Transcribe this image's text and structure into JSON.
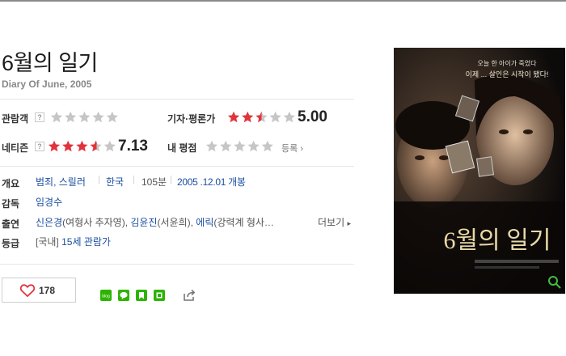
{
  "movie": {
    "title": "6월의 일기",
    "subtitle": "Diary Of June, 2005"
  },
  "ratings": {
    "audience": {
      "label": "관람객",
      "help": "?",
      "score": 0.0
    },
    "critic": {
      "label": "기자·평론가",
      "score": 5.0,
      "score_text": "5.00"
    },
    "netizen": {
      "label": "네티즌",
      "help": "?",
      "score": 7.13,
      "score_text": "7.13"
    },
    "my": {
      "label": "내 평점",
      "score": 0.0,
      "action": "등록"
    }
  },
  "info": {
    "overview_label": "개요",
    "genre": "범죄, 스릴러",
    "country": "한국",
    "runtime": "105분",
    "release": "2005 .12.01 개봉",
    "director_label": "감독",
    "director": "임경수",
    "cast_label": "출연",
    "cast": [
      {
        "name": "신은경",
        "role": "(여형사 추자영)"
      },
      {
        "name": "김윤진",
        "role": "(서윤희)"
      },
      {
        "name": "에릭",
        "role": "(강력계 형사…"
      }
    ],
    "cast_sep": ", ",
    "more_label": "더보기",
    "grade_label": "등급",
    "grade_prefix": "[국내]",
    "grade": "15세 관람가"
  },
  "actions": {
    "like_count": "178",
    "share_icons": [
      "blog-share-icon",
      "line-share-icon",
      "bookmark-share-icon",
      "green-share-icon",
      "share-out-icon"
    ]
  },
  "poster": {
    "tagline_1": "오늘 한 아이가 죽었다",
    "tagline_2": "이제 ... 살인은 시작이 됐다!",
    "title": "6월의 일기"
  },
  "colors": {
    "star_red": "#e0343d",
    "star_gray": "#c6c6c6",
    "star_blue_gray": "#97a3b4",
    "link_blue": "#1a4ea0",
    "like_red": "#e0343d",
    "poster_title": "#e8d9a6"
  }
}
